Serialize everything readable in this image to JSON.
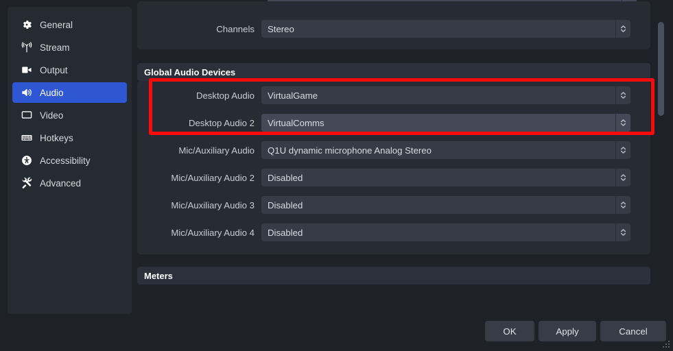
{
  "sidebar": {
    "items": [
      {
        "label": "General",
        "icon": "gear-icon",
        "selected": false
      },
      {
        "label": "Stream",
        "icon": "broadcast-icon",
        "selected": false
      },
      {
        "label": "Output",
        "icon": "camera-icon",
        "selected": false
      },
      {
        "label": "Audio",
        "icon": "speaker-icon",
        "selected": true
      },
      {
        "label": "Video",
        "icon": "monitor-icon",
        "selected": false
      },
      {
        "label": "Hotkeys",
        "icon": "keyboard-icon",
        "selected": false
      },
      {
        "label": "Accessibility",
        "icon": "accessibility-icon",
        "selected": false
      },
      {
        "label": "Advanced",
        "icon": "tools-icon",
        "selected": false
      }
    ]
  },
  "content": {
    "general_group": {
      "rows": [
        {
          "label": "Channels",
          "value": "Stereo",
          "hovered": false
        }
      ]
    },
    "global_audio_devices": {
      "header": "Global Audio Devices",
      "rows": [
        {
          "label": "Desktop Audio",
          "value": "VirtualGame",
          "hovered": false
        },
        {
          "label": "Desktop Audio 2",
          "value": "VirtualComms",
          "hovered": true
        },
        {
          "label": "Mic/Auxiliary Audio",
          "value": "Q1U dynamic microphone Analog Stereo",
          "hovered": false
        },
        {
          "label": "Mic/Auxiliary Audio 2",
          "value": "Disabled",
          "hovered": false
        },
        {
          "label": "Mic/Auxiliary Audio 3",
          "value": "Disabled",
          "hovered": false
        },
        {
          "label": "Mic/Auxiliary Audio 4",
          "value": "Disabled",
          "hovered": false
        }
      ]
    },
    "meters_group": {
      "header": "Meters"
    }
  },
  "annotation": {
    "highlight_color": "#fa0a0a",
    "description": "red-rectangle-around-desktop-audio-rows"
  },
  "buttons": {
    "ok": "OK",
    "apply": "Apply",
    "cancel": "Cancel"
  },
  "theme": {
    "window_bg": "#1e2128",
    "panel_bg": "#262a33",
    "group_bg": "#272b34",
    "field_bg": "#363b46",
    "field_hover_bg": "#434956",
    "accent": "#2f57d3",
    "text": "#d6d9e0",
    "scrollbar_thumb": "#4a505d"
  }
}
